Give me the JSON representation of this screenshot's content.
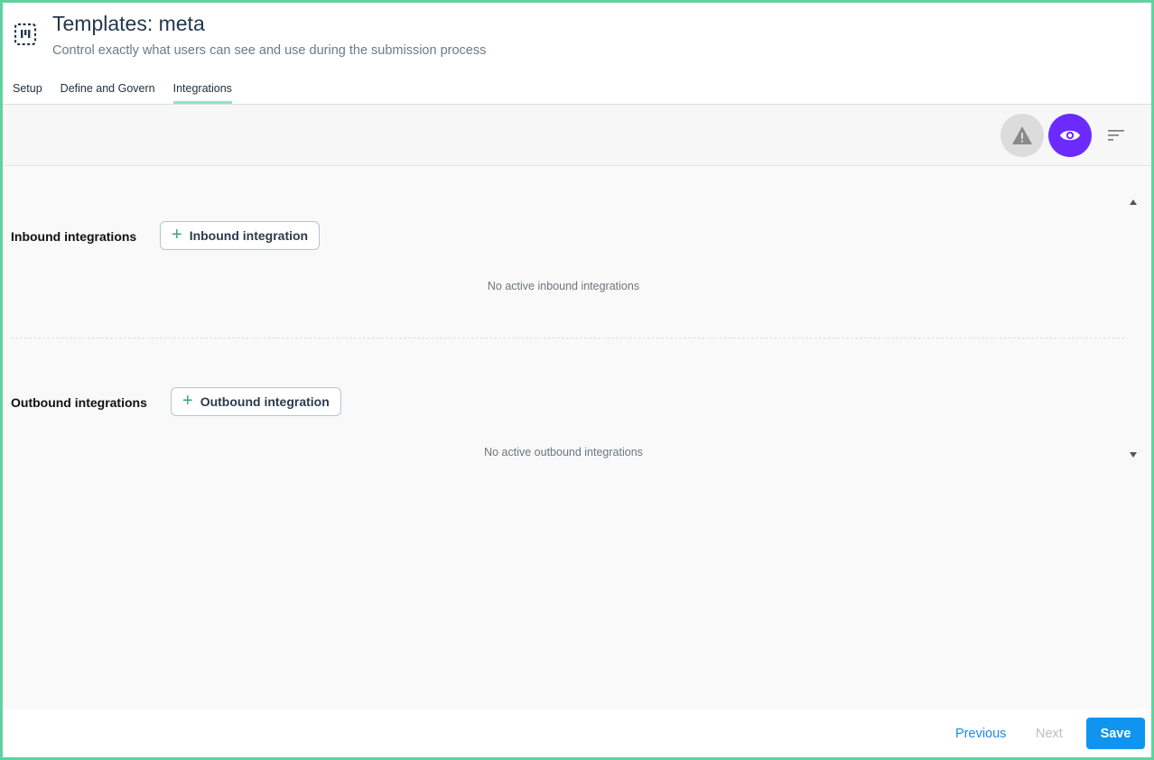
{
  "header": {
    "title": "Templates: meta",
    "subtitle": "Control exactly what users can see and use during the submission process",
    "logo_icon": "template-grid-icon"
  },
  "tabs": [
    {
      "label": "Setup",
      "active": false
    },
    {
      "label": "Define and Govern",
      "active": false
    },
    {
      "label": "Integrations",
      "active": true
    }
  ],
  "toolbar": {
    "warning_icon": "warning-icon",
    "preview_icon": "eye-icon",
    "sort_icon": "sort-icon",
    "preview_color": "#6b2bff"
  },
  "inbound": {
    "title": "Inbound integrations",
    "add_label": "Inbound integration",
    "empty": "No active inbound integrations"
  },
  "outbound": {
    "title": "Outbound integrations",
    "add_label": "Outbound integration",
    "empty": "No active outbound integrations"
  },
  "footer": {
    "previous": "Previous",
    "next": "Next",
    "save": "Save"
  },
  "colors": {
    "accent_green": "#5fd39f",
    "primary_blue": "#0f95f0"
  }
}
